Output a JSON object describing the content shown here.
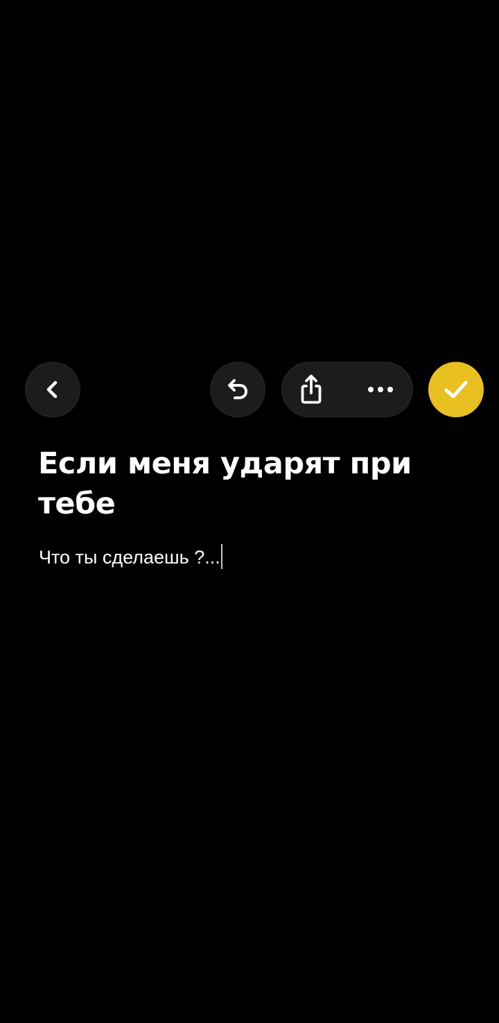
{
  "toolbar": {
    "back_icon": "chevron-left-icon",
    "undo_icon": "undo-icon",
    "share_icon": "share-icon",
    "more_icon": "ellipsis-icon",
    "done_icon": "checkmark-icon",
    "accent_color": "#e8c021",
    "button_bg": "#1c1c1e"
  },
  "note": {
    "title": "Если меня ударят при тебе",
    "body": "Что ты сделаешь ?..."
  }
}
